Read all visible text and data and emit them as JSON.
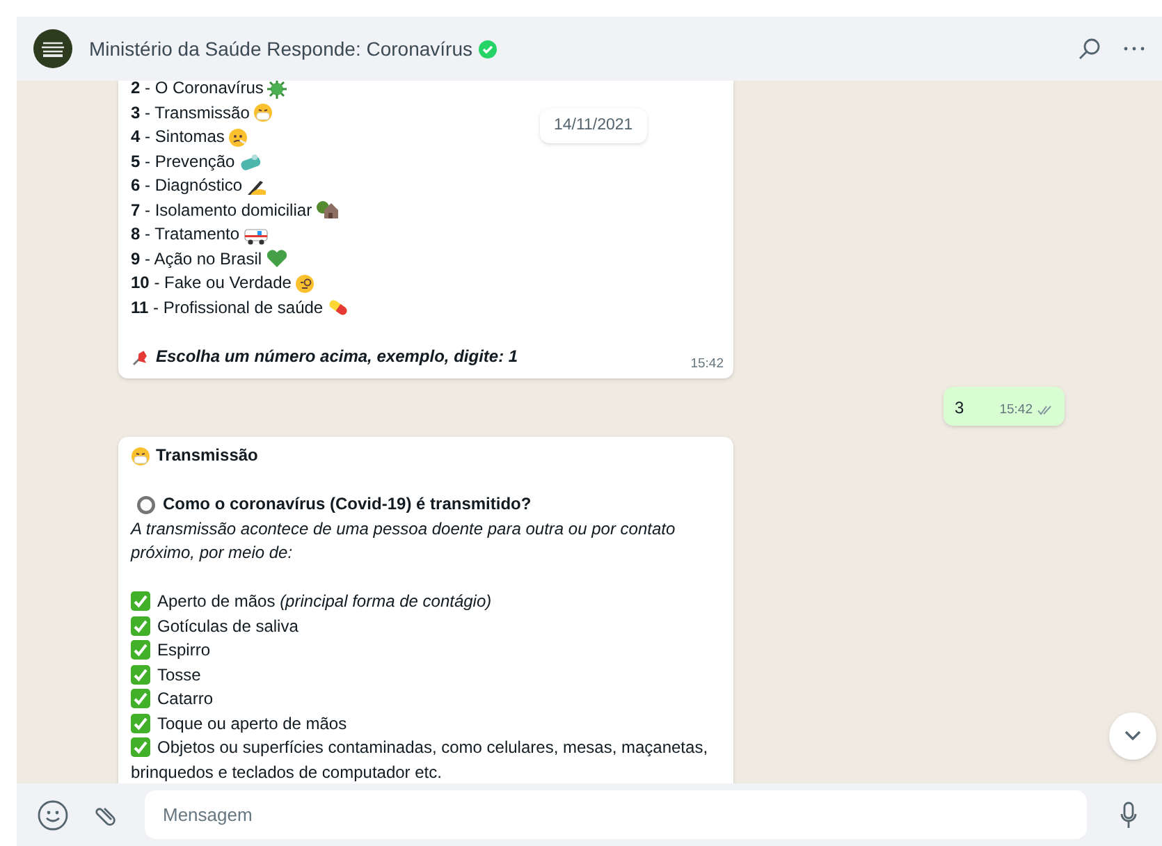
{
  "header": {
    "title": "Ministério da Saúde Responde: Coronavírus",
    "verified": true
  },
  "date_chip": "14/11/2021",
  "messages": [
    {
      "kind": "menu",
      "lines": [
        "**2** - O Coronavírus",
        "**3** - Transmissão",
        "**4** - Sintomas",
        "**5** - Prevenção",
        "**6** - Diagnóstico",
        "**7** - Isolamento domiciliar",
        "**8** - Tratamento",
        "**9** - Ação no Brasil",
        "**10** - Fake ou Verdade",
        "**11** - Profissional de saúde"
      ],
      "footer": "Escolha um número acima, exemplo, digite: 1",
      "time": "15:42"
    },
    {
      "kind": "text",
      "text": "3",
      "time": "15:42",
      "read": false
    },
    {
      "kind": "article",
      "title": "Transmissão",
      "question": "Como o coronavírus (Covid-19) é transmitido?",
      "intro": "A transmissão acontece de uma pessoa doente para outra ou por contato próximo, por meio de:",
      "items": [
        "Aperto de mãos *(principal forma de contágio)*",
        "Gotículas de saliva",
        "Espirro",
        "Tosse",
        "Catarro",
        "Toque ou aperto de mãos",
        "Objetos ou superfícies contaminadas, como celulares, mesas, maçanetas, brinquedos e teclados de computador etc."
      ]
    }
  ],
  "composer": {
    "placeholder": "Mensagem"
  }
}
